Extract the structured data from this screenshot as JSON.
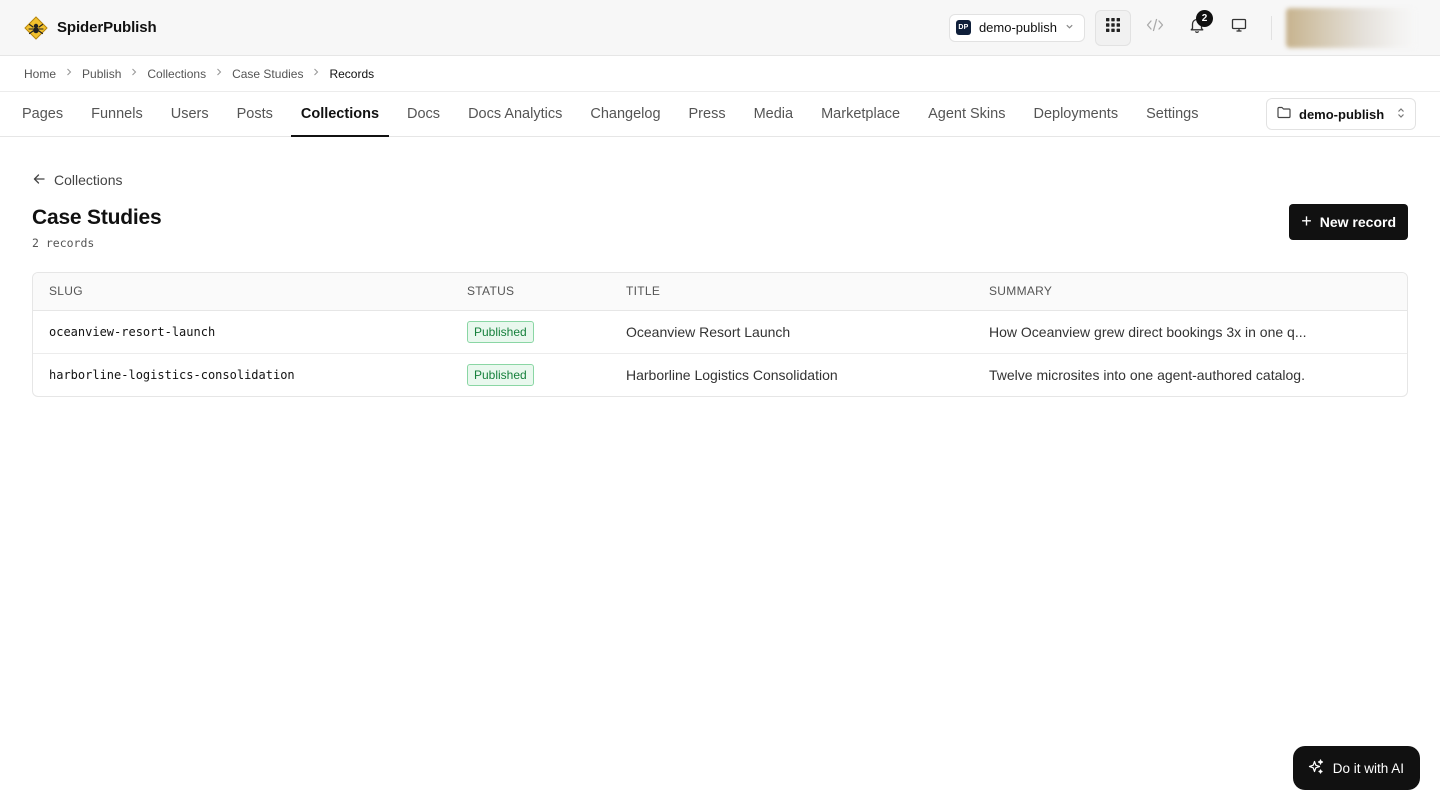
{
  "header": {
    "brand_name": "SpiderPublish",
    "project_switch": {
      "badge": "DP",
      "label": "demo-publish"
    },
    "notifications_count": "2",
    "icons": [
      "apps-grid-icon",
      "code-icon",
      "bell-icon",
      "monitor-icon"
    ]
  },
  "breadcrumb": {
    "items": [
      "Home",
      "Publish",
      "Collections",
      "Case Studies",
      "Records"
    ]
  },
  "nav": {
    "tabs": [
      "Pages",
      "Funnels",
      "Users",
      "Posts",
      "Collections",
      "Docs",
      "Docs Analytics",
      "Changelog",
      "Press",
      "Media",
      "Marketplace",
      "Agent Skins",
      "Deployments",
      "Settings"
    ],
    "active_tab": "Collections",
    "workspace_select": "demo-publish"
  },
  "main": {
    "back_label": "Collections",
    "title": "Case Studies",
    "record_count": "2 records",
    "new_record_label": "New record",
    "table": {
      "columns": [
        "SLUG",
        "STATUS",
        "TITLE",
        "SUMMARY"
      ],
      "rows": [
        {
          "slug": "oceanview-resort-launch",
          "status": "Published",
          "title": "Oceanview Resort Launch",
          "summary": "How Oceanview grew direct bookings 3x in one q..."
        },
        {
          "slug": "harborline-logistics-consolidation",
          "status": "Published",
          "title": "Harborline Logistics Consolidation",
          "summary": "Twelve microsites into one agent-authored catalog."
        }
      ]
    }
  },
  "ai_button_label": "Do it with AI",
  "colors": {
    "accent": "#111111",
    "status_published_text": "#16803c",
    "status_published_bg": "#e9f8ee",
    "logo_yellow": "#f2c12e"
  }
}
